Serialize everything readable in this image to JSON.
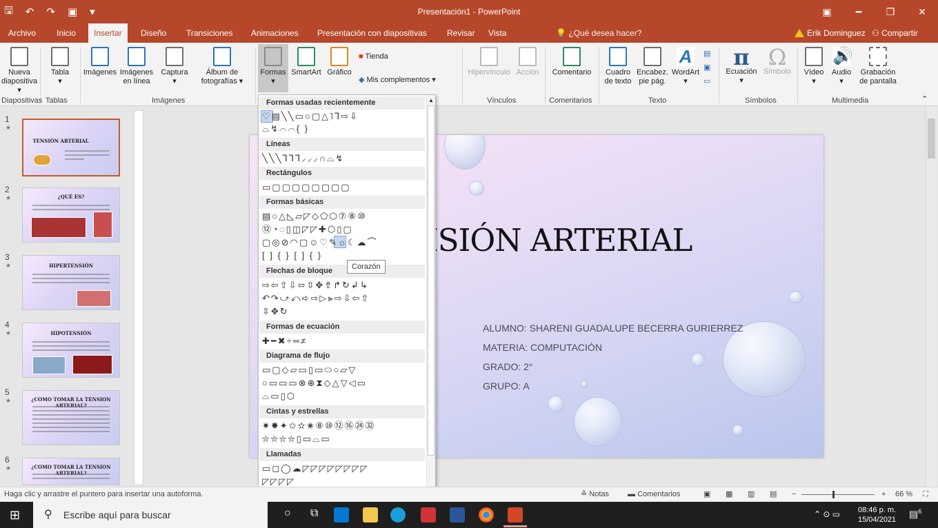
{
  "app": {
    "window_title": "Presentación1 - PowerPoint",
    "user": "Erik Dominguez",
    "share": "Compartir",
    "tell_me": "¿Qué desea hacer?"
  },
  "tabs": [
    {
      "label": "Archivo"
    },
    {
      "label": "Inicio"
    },
    {
      "label": "Insertar"
    },
    {
      "label": "Diseño"
    },
    {
      "label": "Transiciones"
    },
    {
      "label": "Animaciones"
    },
    {
      "label": "Presentación con diapositivas"
    },
    {
      "label": "Revisar"
    },
    {
      "label": "Vista"
    }
  ],
  "active_tab": "Insertar",
  "ribbon": {
    "nueva1": "Nueva",
    "nueva2": "diapositiva",
    "tabla": "Tabla",
    "imagenes": "Imágenes",
    "img_linea1": "Imágenes",
    "img_linea2": "en línea",
    "captura": "Captura",
    "album1": "Álbum de",
    "album2": "fotografías",
    "formas": "Formas",
    "smartart": "SmartArt",
    "grafico": "Gráfico",
    "tienda": "Tienda",
    "complementos": "Mis complementos",
    "hipervinculo": "Hipervínculo",
    "accion": "Acción",
    "comentario": "Comentario",
    "cuadro1": "Cuadro",
    "cuadro2": "de texto",
    "encabez1": "Encabez.",
    "encabez2": "pie pág.",
    "wordart": "WordArt",
    "ecuacion": "Ecuación",
    "simbolo": "Símbolo",
    "video": "Vídeo",
    "audio": "Audio",
    "grabacion1": "Grabación",
    "grabacion2": "de pantalla",
    "groups": {
      "diapositivas": "Diapositivas",
      "tablas": "Tablas",
      "imagenes": "Imágenes",
      "vinculos": "Vínculos",
      "comentarios": "Comentarios",
      "texto": "Texto",
      "simbolos": "Símbolos",
      "multimedia": "Multimedia"
    }
  },
  "shapes_menu": {
    "sections": [
      {
        "title": "Formas usadas recientemente",
        "rows": [
          "♡▤╲╲▭○▢△˥⅂⇨⇩",
          "⌓↯⌒⌒{ }"
        ]
      },
      {
        "title": "Líneas",
        "rows": [
          "╲╲╲⅂⅂⅂⸝⸝⸝∩⌓↯"
        ]
      },
      {
        "title": "Rectángulos",
        "rows": [
          "▭▢▢▢▢▢▢▢▢"
        ]
      },
      {
        "title": "Formas básicas",
        "rows": [
          "▤○△◺▱◸◇⬠⬡⑦⑧⑩",
          "⑫◔◌▯◫◸◸✚⬡▯▢",
          "▢◎⊘◠▢☺♡✎☼☾☁⌒",
          "[ ] { } [ ] { }"
        ]
      },
      {
        "title": "Flechas de bloque",
        "rows": [
          "⇨⇦⇧⇩⬄⇳✥⇮↱↻↲↳",
          "↶↷⤻⤺➪⇨▷⪢⇨⇩⇦⇧",
          "⇳✥↻"
        ]
      },
      {
        "title": "Formas de ecuación",
        "rows": [
          "✚━✖÷═≠"
        ]
      },
      {
        "title": "Diagrama de flujo",
        "rows": [
          "▭▢◇▱▭▯▭⬭○▱▽",
          "○▭▭▭⊗⊕⧗◇△▽◁▭",
          "⌓▭▯⬡"
        ]
      },
      {
        "title": "Cintas y estrellas",
        "rows": [
          "✷✸✦✩✫✬⑧⑩⑫⑯㉔㉜",
          "⛦⛦⛦⛦▯▭⌓▭"
        ]
      },
      {
        "title": "Llamadas",
        "rows": [
          "▭◻◯☁◸◸◸◸◸◸◸◸",
          "◸◸◸◸"
        ]
      }
    ],
    "tooltip": "Corazón"
  },
  "slides": [
    {
      "num": "1",
      "title": "TENSIÓN ARTERIAL"
    },
    {
      "num": "2",
      "title": "¿QUÉ ES?"
    },
    {
      "num": "3",
      "title": "HIPERTENSIÓN"
    },
    {
      "num": "4",
      "title": "HIPOTENSIÓN"
    },
    {
      "num": "5",
      "title": "¿COMO TOMAR LA TENSION ARTERIAL?"
    },
    {
      "num": "6",
      "title": "¿COMO TOMAR LA TENSION ARTERIAL?"
    }
  ],
  "slide": {
    "title": "ISIÓN ARTERIAL",
    "lines": [
      "ALUMNO: SHARENI GUADALUPE BECERRA GURIERREZ",
      "MATERIA: COMPUTACIÓN",
      "GRADO: 2°",
      "GRUPO: A"
    ]
  },
  "status": {
    "hint": "Haga clic y arrastre el puntero para insertar una autoforma.",
    "notes": "Notas",
    "comments": "Comentarios",
    "zoom": "66 %",
    "zoom_fraction": 0.42
  },
  "taskbar": {
    "search_placeholder": "Escribe aquí para buscar",
    "time": "08:46 p. m.",
    "date": "15/04/2021",
    "notifications": "6"
  },
  "colors": {
    "accent": "#b7472a",
    "ribbon_bg": "#f3f3f3",
    "taskbar": "#1f1f1f"
  }
}
